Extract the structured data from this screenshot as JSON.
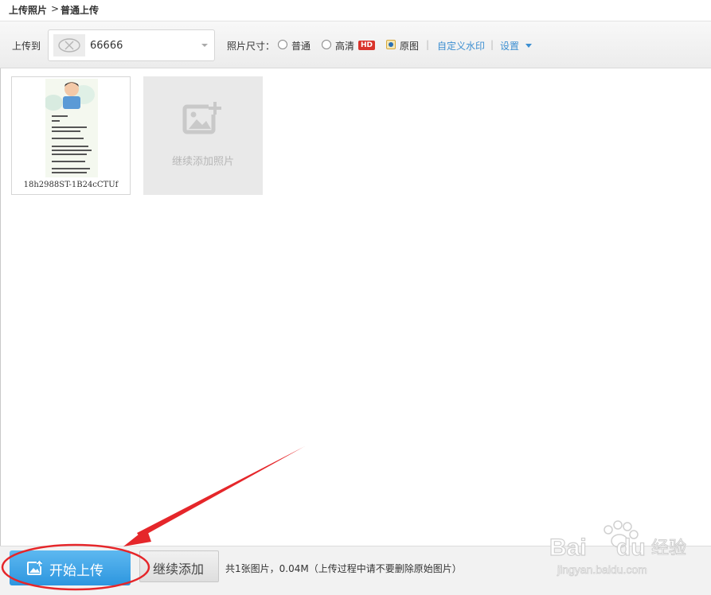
{
  "breadcrumb": {
    "root": "上传照片",
    "separator": ">",
    "current": "普通上传"
  },
  "toolbar": {
    "upload_to_label": "上传到",
    "album_name": "66666",
    "size_label": "照片尺寸：",
    "size_options": [
      {
        "label": "普通",
        "selected": false
      },
      {
        "label": "高清",
        "selected": false,
        "badge": "HD"
      },
      {
        "label": "原图",
        "selected": true
      }
    ],
    "watermark_link": "自定义水印",
    "divider": "|",
    "settings_link": "设置"
  },
  "photos": [
    {
      "filename": "18h2988ST-1B24cCTUf"
    }
  ],
  "add_tile": {
    "label": "继续添加照片"
  },
  "footer": {
    "start_upload": "开始上传",
    "continue_add": "继续添加",
    "summary": "共1张图片，0.04M（上传过程中请不要删除原始图片）"
  },
  "watermark": {
    "text": "Baidu经验",
    "url_text": "jingyan.baidu.com"
  },
  "colors": {
    "accent": "#3d8fd1",
    "start_button": "#3aa3e6",
    "annotation": "#e5262a",
    "hd_badge": "#d9342b"
  }
}
